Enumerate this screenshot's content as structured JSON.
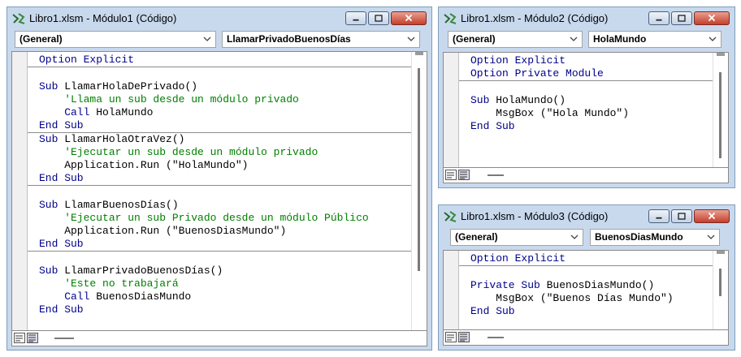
{
  "colors": {
    "keyword": "#00008b",
    "comment": "#008000",
    "text": "#000000",
    "window_frame": "#c8d9ee",
    "close_button": "#c63e2a"
  },
  "windows": [
    {
      "title": "Libro1.xlsm - Módulo1 (Código)",
      "object_combo": "(General)",
      "procedure_combo": "LlamarPrivadoBuenosDías",
      "lines": [
        [
          {
            "t": "Option Explicit",
            "k": "kw"
          }
        ],
        [],
        [
          {
            "t": "Sub ",
            "k": "kw"
          },
          {
            "t": "LlamarHolaDePrivado()",
            "k": "tx"
          }
        ],
        [
          {
            "t": "    'Llama un sub desde un módulo privado",
            "k": "cm"
          }
        ],
        [
          {
            "t": "    Call ",
            "k": "kw"
          },
          {
            "t": "HolaMundo",
            "k": "tx"
          }
        ],
        [
          {
            "t": "End Sub",
            "k": "kw"
          }
        ],
        [
          {
            "t": "Sub ",
            "k": "kw"
          },
          {
            "t": "LlamarHolaOtraVez()",
            "k": "tx"
          }
        ],
        [
          {
            "t": "    'Ejecutar un sub desde un módulo privado",
            "k": "cm"
          }
        ],
        [
          {
            "t": "    Application.Run (\"HolaMundo\")",
            "k": "tx"
          }
        ],
        [
          {
            "t": "End Sub",
            "k": "kw"
          }
        ],
        [],
        [
          {
            "t": "Sub ",
            "k": "kw"
          },
          {
            "t": "LlamarBuenosDías()",
            "k": "tx"
          }
        ],
        [
          {
            "t": "    'Ejecutar un sub Privado desde un módulo Público",
            "k": "cm"
          }
        ],
        [
          {
            "t": "    Application.Run (\"BuenosDiasMundo\")",
            "k": "tx"
          }
        ],
        [
          {
            "t": "End Sub",
            "k": "kw"
          }
        ],
        [],
        [
          {
            "t": "Sub ",
            "k": "kw"
          },
          {
            "t": "LlamarPrivadoBuenosDías()",
            "k": "tx"
          }
        ],
        [
          {
            "t": "    'Este no trabajará",
            "k": "cm"
          }
        ],
        [
          {
            "t": "    Call ",
            "k": "kw"
          },
          {
            "t": "BuenosDiasMundo",
            "k": "tx"
          }
        ],
        [
          {
            "t": "End Sub",
            "k": "kw"
          }
        ]
      ],
      "separators": [
        0,
        5,
        9,
        14
      ]
    },
    {
      "title": "Libro1.xlsm - Módulo2 (Código)",
      "object_combo": "(General)",
      "procedure_combo": "HolaMundo",
      "lines": [
        [
          {
            "t": "Option Explicit",
            "k": "kw"
          }
        ],
        [
          {
            "t": "Option Private Module",
            "k": "kw"
          }
        ],
        [],
        [
          {
            "t": "Sub ",
            "k": "kw"
          },
          {
            "t": "HolaMundo()",
            "k": "tx"
          }
        ],
        [
          {
            "t": "    MsgBox (\"Hola Mundo\")",
            "k": "tx"
          }
        ],
        [
          {
            "t": "End Sub",
            "k": "kw"
          }
        ]
      ],
      "separators": [
        1
      ]
    },
    {
      "title": "Libro1.xlsm - Módulo3 (Código)",
      "object_combo": "(General)",
      "procedure_combo": "BuenosDiasMundo",
      "lines": [
        [
          {
            "t": "Option Explicit",
            "k": "kw"
          }
        ],
        [],
        [
          {
            "t": "Private Sub ",
            "k": "kw"
          },
          {
            "t": "BuenosDiasMundo()",
            "k": "tx"
          }
        ],
        [
          {
            "t": "    MsgBox (\"Buenos Días Mundo\")",
            "k": "tx"
          }
        ],
        [
          {
            "t": "End Sub",
            "k": "kw"
          }
        ]
      ],
      "separators": [
        0
      ]
    }
  ]
}
